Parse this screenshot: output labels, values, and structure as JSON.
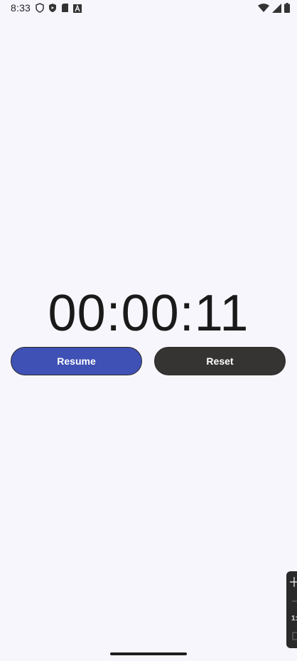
{
  "status_bar": {
    "time": "8:33",
    "left_icons": [
      "shield-icon",
      "play-protect-icon",
      "sd-card-icon",
      "font-icon"
    ],
    "right_icons": [
      "wifi-icon",
      "signal-icon",
      "battery-icon"
    ]
  },
  "stopwatch": {
    "elapsed": "00:00:11"
  },
  "buttons": {
    "resume_label": "Resume",
    "reset_label": "Reset"
  },
  "side_panel": {
    "text": "1:"
  },
  "colors": {
    "background": "#f8f6fd",
    "resume": "#3f51b5",
    "reset": "#363432"
  }
}
